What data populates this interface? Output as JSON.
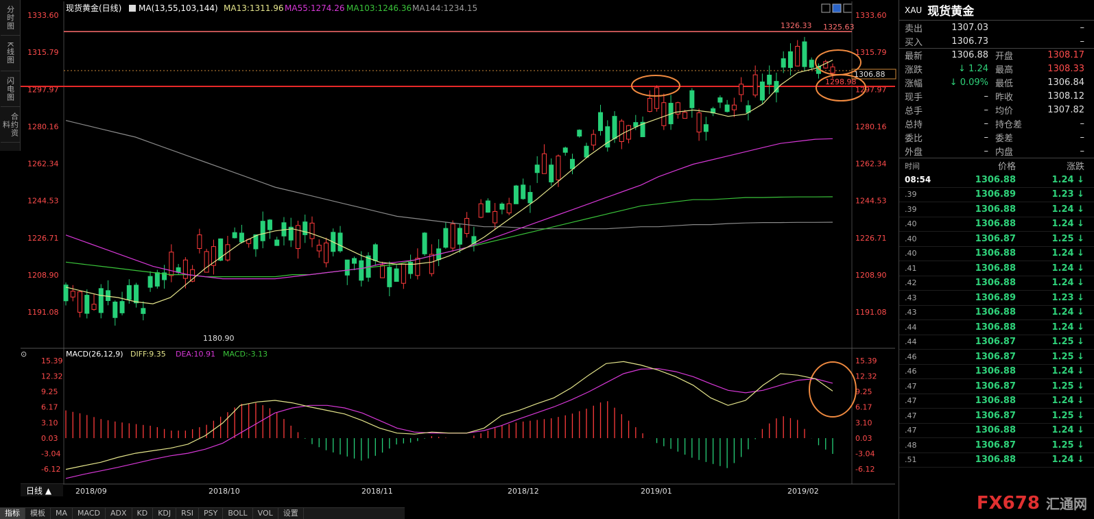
{
  "sidebar": {
    "tabs": [
      "分时图",
      "K线图",
      "闪电图",
      "合约资料"
    ]
  },
  "chart_header": {
    "symbol": "现货黄金(日线)",
    "ma_label": "MA(13,55,103,144)",
    "ma13": "MA13:1311.96",
    "ma55": "MA55:1274.26",
    "ma103": "MA103:1246.36",
    "ma144": "MA144:1234.15"
  },
  "macd_header": {
    "label": "MACD(26,12,9)",
    "diff": "DIFF:9.35",
    "dea": "DEA:10.91",
    "macd": "MACD:-3.13"
  },
  "price_axis": [
    "1333.60",
    "1315.79",
    "1297.97",
    "1280.16",
    "1262.34",
    "1244.53",
    "1226.71",
    "1208.90",
    "1191.08"
  ],
  "macd_axis": [
    "15.39",
    "12.32",
    "9.25",
    "6.17",
    "3.10",
    "0.03",
    "-3.04",
    "-6.12"
  ],
  "date_axis": [
    "2018/09",
    "2018/10",
    "2018/11",
    "2018/12",
    "2019/01",
    "2019/02"
  ],
  "annotations": {
    "low": "1180.90",
    "high": "1326.33",
    "resist": "1325.63",
    "support": "1298.98",
    "last": "1306.88"
  },
  "colors": {
    "up": "#ff3b3b",
    "down": "#26d078",
    "ma13": "#e6e68c",
    "ma55": "#d838d8",
    "ma103": "#3ac43a",
    "ma144": "#888888",
    "diff": "#e6e68c",
    "dea": "#d838d8",
    "resist_line": "#ff6060",
    "circle": "#f08a40"
  },
  "bottom_bar": {
    "period": "日线 ▲",
    "tabs": [
      "指标",
      "模板",
      "MA",
      "MACD",
      "ADX",
      "KD",
      "KDJ",
      "RSI",
      "PSY",
      "BOLL",
      "VOL",
      "设置"
    ]
  },
  "quote": {
    "code": "XAU",
    "name": "现货黄金",
    "rows": [
      {
        "l": "卖出",
        "v": "1307.03",
        "r": "",
        "v2": "–"
      },
      {
        "l": "买入",
        "v": "1306.73",
        "r": "",
        "v2": "–"
      },
      {
        "l": "最新",
        "v": "1306.88",
        "r": "开盘",
        "v2": "1308.17"
      },
      {
        "l": "涨跌",
        "v": "↓ 1.24",
        "r": "最高",
        "v2": "1308.33"
      },
      {
        "l": "涨幅",
        "v": "↓ 0.09%",
        "r": "最低",
        "v2": "1306.84"
      },
      {
        "l": "现手",
        "v": "–",
        "r": "昨收",
        "v2": "1308.12"
      },
      {
        "l": "总手",
        "v": "–",
        "r": "均价",
        "v2": "1307.82"
      },
      {
        "l": "总持",
        "v": "–",
        "r": "持仓差",
        "v2": "–"
      },
      {
        "l": "委比",
        "v": "–",
        "r": "委差",
        "v2": "–"
      },
      {
        "l": "外盘",
        "v": "–",
        "r": "内盘",
        "v2": "–"
      }
    ],
    "ticks_header": [
      "时间",
      "价格",
      "涨跌"
    ],
    "ticks": [
      {
        "t": "08:54",
        "p": "1306.88",
        "c": "1.24 ↓"
      },
      {
        "t": ".39",
        "p": "1306.89",
        "c": "1.23 ↓"
      },
      {
        "t": ".39",
        "p": "1306.88",
        "c": "1.24 ↓"
      },
      {
        "t": ".40",
        "p": "1306.88",
        "c": "1.24 ↓"
      },
      {
        "t": ".40",
        "p": "1306.87",
        "c": "1.25 ↓"
      },
      {
        "t": ".40",
        "p": "1306.88",
        "c": "1.24 ↓"
      },
      {
        "t": ".41",
        "p": "1306.88",
        "c": "1.24 ↓"
      },
      {
        "t": ".42",
        "p": "1306.88",
        "c": "1.24 ↓"
      },
      {
        "t": ".43",
        "p": "1306.89",
        "c": "1.23 ↓"
      },
      {
        "t": ".43",
        "p": "1306.88",
        "c": "1.24 ↓"
      },
      {
        "t": ".44",
        "p": "1306.88",
        "c": "1.24 ↓"
      },
      {
        "t": ".44",
        "p": "1306.87",
        "c": "1.25 ↓"
      },
      {
        "t": ".46",
        "p": "1306.87",
        "c": "1.25 ↓"
      },
      {
        "t": ".46",
        "p": "1306.88",
        "c": "1.24 ↓"
      },
      {
        "t": ".47",
        "p": "1306.87",
        "c": "1.25 ↓"
      },
      {
        "t": ".47",
        "p": "1306.88",
        "c": "1.24 ↓"
      },
      {
        "t": ".47",
        "p": "1306.87",
        "c": "1.25 ↓"
      },
      {
        "t": ".47",
        "p": "1306.88",
        "c": "1.24 ↓"
      },
      {
        "t": ".48",
        "p": "1306.87",
        "c": "1.25 ↓"
      },
      {
        "t": ".51",
        "p": "1306.88",
        "c": "1.24 ↓"
      }
    ],
    "logo": "FX678",
    "logo_sub": "汇通网"
  },
  "chart_data": {
    "type": "candlestick",
    "price_range": [
      1180.9,
      1333.6
    ],
    "macd_range": [
      -7.5,
      15.39
    ],
    "ma_curves": {
      "ma13": [
        1203,
        1201,
        1199,
        1198,
        1196,
        1195,
        1198,
        1205,
        1212,
        1218,
        1224,
        1228,
        1230,
        1231,
        1229,
        1226,
        1222,
        1218,
        1215,
        1214,
        1214,
        1215,
        1218,
        1222,
        1227,
        1233,
        1239,
        1245,
        1252,
        1259,
        1266,
        1272,
        1277,
        1281,
        1284,
        1287,
        1288,
        1287,
        1285,
        1286,
        1291,
        1300,
        1306,
        1308,
        1311.96
      ],
      "ma55": [
        1228,
        1225,
        1222,
        1219,
        1216,
        1213,
        1211,
        1209,
        1208,
        1207,
        1207,
        1207,
        1207,
        1208,
        1209,
        1210,
        1211,
        1212,
        1214,
        1215,
        1216,
        1218,
        1220,
        1222,
        1225,
        1228,
        1231,
        1234,
        1237,
        1240,
        1243,
        1246,
        1249,
        1252,
        1256,
        1259,
        1262,
        1264,
        1266,
        1268,
        1270,
        1272,
        1273,
        1274,
        1274.26
      ],
      "ma103": [
        1215,
        1214,
        1213,
        1212,
        1211,
        1210,
        1209,
        1209,
        1208,
        1208,
        1208,
        1208,
        1208,
        1209,
        1209,
        1210,
        1211,
        1212,
        1213,
        1214,
        1216,
        1218,
        1220,
        1222,
        1224,
        1226,
        1228,
        1230,
        1232,
        1234,
        1236,
        1238,
        1240,
        1242,
        1243,
        1244,
        1245,
        1245,
        1245.5,
        1246,
        1246,
        1246.2,
        1246.3,
        1246.3,
        1246.36
      ],
      "ma144": [
        1283,
        1281,
        1279,
        1277,
        1275,
        1272,
        1269,
        1266,
        1263,
        1260,
        1257,
        1254,
        1251,
        1249,
        1247,
        1245,
        1243,
        1241,
        1239,
        1237,
        1236,
        1235,
        1234,
        1233,
        1232,
        1232,
        1231.5,
        1231,
        1231,
        1231,
        1231,
        1231,
        1231.5,
        1232,
        1232,
        1232.5,
        1233,
        1233,
        1233.5,
        1233.8,
        1234,
        1234,
        1234.1,
        1234.1,
        1234.15
      ]
    },
    "macd": {
      "diff": [
        -6.2,
        -5.5,
        -4.8,
        -3.8,
        -3.0,
        -2.5,
        -2.0,
        -1.2,
        0.5,
        3.0,
        6.5,
        7.2,
        7.5,
        7.0,
        6.2,
        5.5,
        4.8,
        3.5,
        2.0,
        1.0,
        0.8,
        1.2,
        1.0,
        1.0,
        2.0,
        4.5,
        5.5,
        6.8,
        8.0,
        10.0,
        12.5,
        14.8,
        15.2,
        14.5,
        13.5,
        12.2,
        10.5,
        8.0,
        6.5,
        7.5,
        10.5,
        12.8,
        12.5,
        11.8,
        9.35
      ],
      "dea": [
        -8,
        -7.2,
        -6.5,
        -5.8,
        -5.0,
        -4.2,
        -3.5,
        -3.0,
        -2.2,
        -1.0,
        1.0,
        3.0,
        5.0,
        6.0,
        6.5,
        6.5,
        6.0,
        5.0,
        3.5,
        2.0,
        1.2,
        1.0,
        1.0,
        1.0,
        1.5,
        2.5,
        3.8,
        5.0,
        6.2,
        7.6,
        9.2,
        11.0,
        12.8,
        13.7,
        13.8,
        13.2,
        12.2,
        10.8,
        9.5,
        9.0,
        9.5,
        10.5,
        11.5,
        11.8,
        10.91
      ],
      "hist": [
        5.5,
        4.8,
        3.8,
        3.2,
        2.8,
        2.4,
        1.5,
        1.5,
        2.5,
        4.5,
        6.8,
        7.0,
        5.5,
        2.2,
        -1.0,
        -2.5,
        -3.5,
        -4.5,
        -3.2,
        -1.2,
        -0.8,
        0.4,
        0.0,
        0.0,
        1.2,
        2.5,
        3.2,
        3.6,
        4.0,
        4.8,
        6.0,
        7.6,
        4.4,
        1.2,
        -1.2,
        -2.5,
        -4.0,
        -5.0,
        -6.0,
        -3.0,
        2.0,
        4.5,
        3.6,
        -1.0,
        -3.13
      ]
    }
  }
}
